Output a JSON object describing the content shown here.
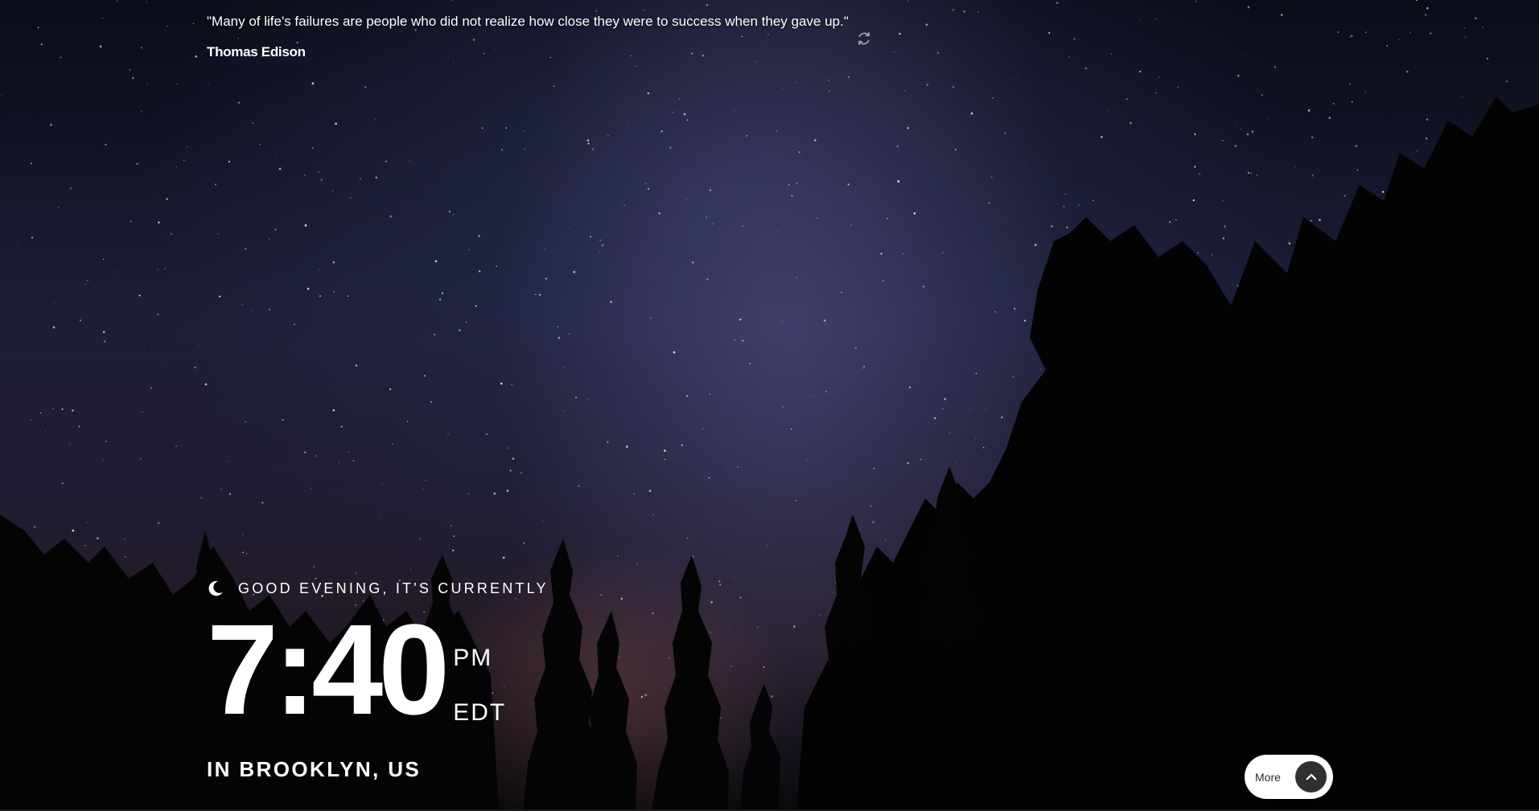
{
  "quote": {
    "text": "\"Many of life's failures are people who did not realize how close they were to success when they gave up.\"",
    "author": "Thomas Edison",
    "refresh_icon": "refresh-icon"
  },
  "clock": {
    "greeting_icon": "moon-icon",
    "greeting": "GOOD EVENING, IT'S CURRENTLY",
    "time": "7:40",
    "ampm": "PM",
    "timezone": "EDT",
    "location": "IN BROOKLYN, US"
  },
  "more_button": {
    "label": "More",
    "icon": "chevron-up-icon"
  },
  "colors": {
    "text": "#ffffff",
    "button_bg": "#ffffff",
    "chevron_bg": "#303030"
  }
}
